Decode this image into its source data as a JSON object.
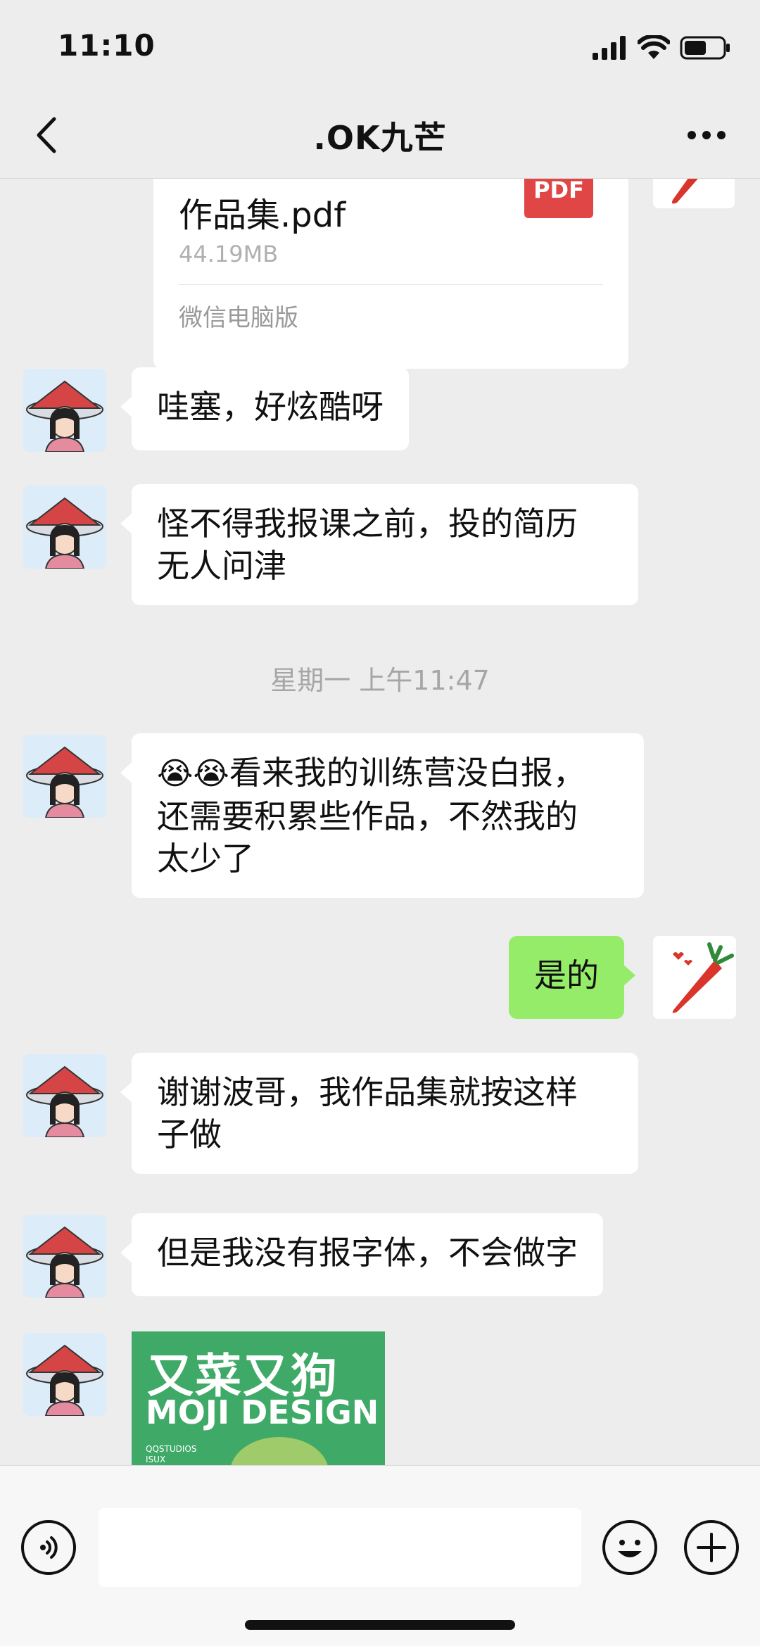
{
  "status_bar": {
    "time": "11:10"
  },
  "header": {
    "title": ".OK九芒"
  },
  "messages": {
    "file": {
      "name": "作品集.pdf",
      "size": "44.19MB",
      "badge": "PDF",
      "source": "微信电脑版"
    },
    "m1": "哇塞，好炫酷呀",
    "m2_line1": "怪不得我报课之前，投的简历",
    "m2_line2": "无人问津",
    "timestamp": "星期一 上午11:47",
    "m3_line1": "看来我的训练营没白报，",
    "m3_line2": "还需要积累些作品，不然我的",
    "m3_line3": "太少了",
    "m3_emoji": "😭😭",
    "m4": "是的",
    "m5_line1": "谢谢波哥，我作品集就按这样",
    "m5_line2": "子做",
    "m6": "但是我没有报字体，不会做字",
    "image": {
      "title_cn": "又菜又狗",
      "title_en": "MOJI DESIGN",
      "small1": "QQSTUDIOS",
      "small2": "ISUX"
    }
  },
  "colors": {
    "background": "#ededed",
    "self_bubble": "#95ec69",
    "pdf_badge": "#e04646"
  },
  "icons": {
    "back": "chevron-left-icon",
    "more": "more-dots-icon",
    "voice": "voice-icon",
    "emoji": "emoji-icon",
    "plus": "plus-icon",
    "signal": "signal-icon",
    "wifi": "wifi-icon",
    "battery": "battery-icon"
  }
}
